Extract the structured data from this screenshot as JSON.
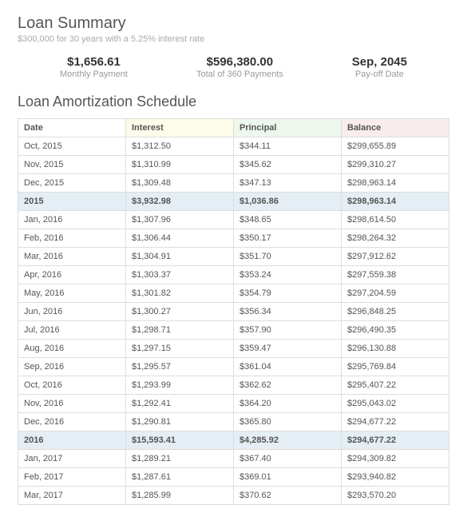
{
  "header": {
    "title": "Loan Summary",
    "subtitle": "$300,000 for 30 years with a 5.25% interest rate"
  },
  "metrics": [
    {
      "value": "$1,656.61",
      "label": "Monthly Payment"
    },
    {
      "value": "$596,380.00",
      "label": "Total of 360 Payments"
    },
    {
      "value": "Sep, 2045",
      "label": "Pay-off Date"
    }
  ],
  "schedule": {
    "title": "Loan Amortization Schedule",
    "columns": [
      "Date",
      "Interest",
      "Principal",
      "Balance"
    ],
    "rows": [
      {
        "type": "row",
        "cells": [
          "Oct, 2015",
          "$1,312.50",
          "$344.11",
          "$299,655.89"
        ]
      },
      {
        "type": "row",
        "cells": [
          "Nov, 2015",
          "$1,310.99",
          "$345.62",
          "$299,310.27"
        ]
      },
      {
        "type": "row",
        "cells": [
          "Dec, 2015",
          "$1,309.48",
          "$347.13",
          "$298,963.14"
        ]
      },
      {
        "type": "summary",
        "cells": [
          "2015",
          "$3,932.98",
          "$1,036.86",
          "$298,963.14"
        ]
      },
      {
        "type": "row",
        "cells": [
          "Jan, 2016",
          "$1,307.96",
          "$348.65",
          "$298,614.50"
        ]
      },
      {
        "type": "row",
        "cells": [
          "Feb, 2016",
          "$1,306.44",
          "$350.17",
          "$298,264.32"
        ]
      },
      {
        "type": "row",
        "cells": [
          "Mar, 2016",
          "$1,304.91",
          "$351.70",
          "$297,912.62"
        ]
      },
      {
        "type": "row",
        "cells": [
          "Apr, 2016",
          "$1,303.37",
          "$353.24",
          "$297,559.38"
        ]
      },
      {
        "type": "row",
        "cells": [
          "May, 2016",
          "$1,301.82",
          "$354.79",
          "$297,204.59"
        ]
      },
      {
        "type": "row",
        "cells": [
          "Jun, 2016",
          "$1,300.27",
          "$356.34",
          "$296,848.25"
        ]
      },
      {
        "type": "row",
        "cells": [
          "Jul, 2016",
          "$1,298.71",
          "$357.90",
          "$296,490.35"
        ]
      },
      {
        "type": "row",
        "cells": [
          "Aug, 2016",
          "$1,297.15",
          "$359.47",
          "$296,130.88"
        ]
      },
      {
        "type": "row",
        "cells": [
          "Sep, 2016",
          "$1,295.57",
          "$361.04",
          "$295,769.84"
        ]
      },
      {
        "type": "row",
        "cells": [
          "Oct, 2016",
          "$1,293.99",
          "$362.62",
          "$295,407.22"
        ]
      },
      {
        "type": "row",
        "cells": [
          "Nov, 2016",
          "$1,292.41",
          "$364.20",
          "$295,043.02"
        ]
      },
      {
        "type": "row",
        "cells": [
          "Dec, 2016",
          "$1,290.81",
          "$365.80",
          "$294,677.22"
        ]
      },
      {
        "type": "summary",
        "cells": [
          "2016",
          "$15,593.41",
          "$4,285.92",
          "$294,677.22"
        ]
      },
      {
        "type": "row",
        "cells": [
          "Jan, 2017",
          "$1,289.21",
          "$367.40",
          "$294,309.82"
        ]
      },
      {
        "type": "row",
        "cells": [
          "Feb, 2017",
          "$1,287.61",
          "$369.01",
          "$293,940.82"
        ]
      },
      {
        "type": "row",
        "cells": [
          "Mar, 2017",
          "$1,285.99",
          "$370.62",
          "$293,570.20"
        ]
      }
    ]
  }
}
